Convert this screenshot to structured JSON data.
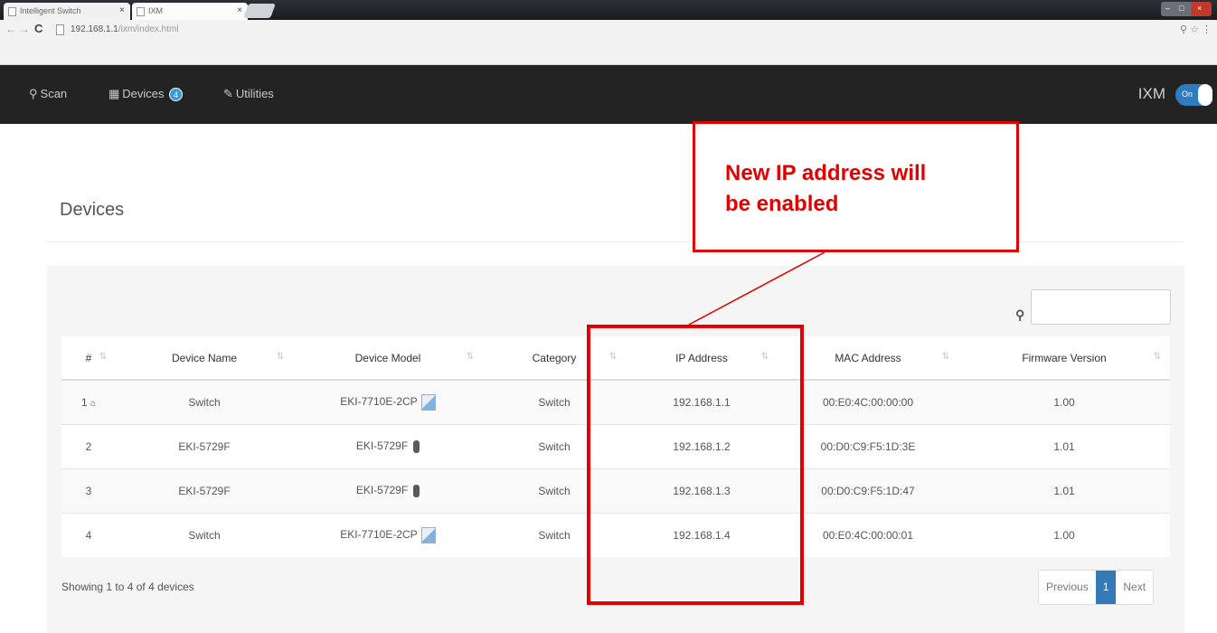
{
  "browser": {
    "tabs": [
      {
        "title": "Intelligent Switch"
      },
      {
        "title": "IXM"
      }
    ],
    "address": {
      "host": "192.168.1.1",
      "path": "/ixm/index.html"
    }
  },
  "navbar": {
    "items": [
      {
        "label": "Scan",
        "icon": "search-icon"
      },
      {
        "label": "Devices",
        "icon": "grid-icon",
        "badge": "4"
      },
      {
        "label": "Utilities",
        "icon": "wrench-icon"
      }
    ],
    "brand": "IXM",
    "toggle_label": "On"
  },
  "page": {
    "title": "Devices"
  },
  "table": {
    "columns": [
      "#",
      "Device Name",
      "Device Model",
      "Category",
      "IP Address",
      "MAC Address",
      "Firmware Version"
    ],
    "rows": [
      {
        "num": "1",
        "name": "Switch",
        "model": "EKI-7710E-2CP",
        "category": "Switch",
        "ip": "192.168.1.1",
        "mac": "00:E0:4C:00:00:00",
        "firmware": "1.00"
      },
      {
        "num": "2",
        "name": "EKI-5729F",
        "model": "EKI-5729F",
        "category": "Switch",
        "ip": "192.168.1.2",
        "mac": "00:D0:C9:F5:1D:3E",
        "firmware": "1.01"
      },
      {
        "num": "3",
        "name": "EKI-5729F",
        "model": "EKI-5729F",
        "category": "Switch",
        "ip": "192.168.1.3",
        "mac": "00:D0:C9:F5:1D:47",
        "firmware": "1.01"
      },
      {
        "num": "4",
        "name": "Switch",
        "model": "EKI-7710E-2CP",
        "category": "Switch",
        "ip": "192.168.1.4",
        "mac": "00:E0:4C:00:00:01",
        "firmware": "1.00"
      }
    ],
    "footer": "Showing 1 to 4 of 4 devices"
  },
  "pagination": {
    "previous": "Previous",
    "current": "1",
    "next": "Next"
  },
  "annotation": {
    "line1": "New IP address will",
    "line2": "be enabled",
    "color": "#e00000"
  },
  "colors": {
    "navbar": "#232323",
    "accent": "#337ab7",
    "badge": "#3c9ad8"
  }
}
